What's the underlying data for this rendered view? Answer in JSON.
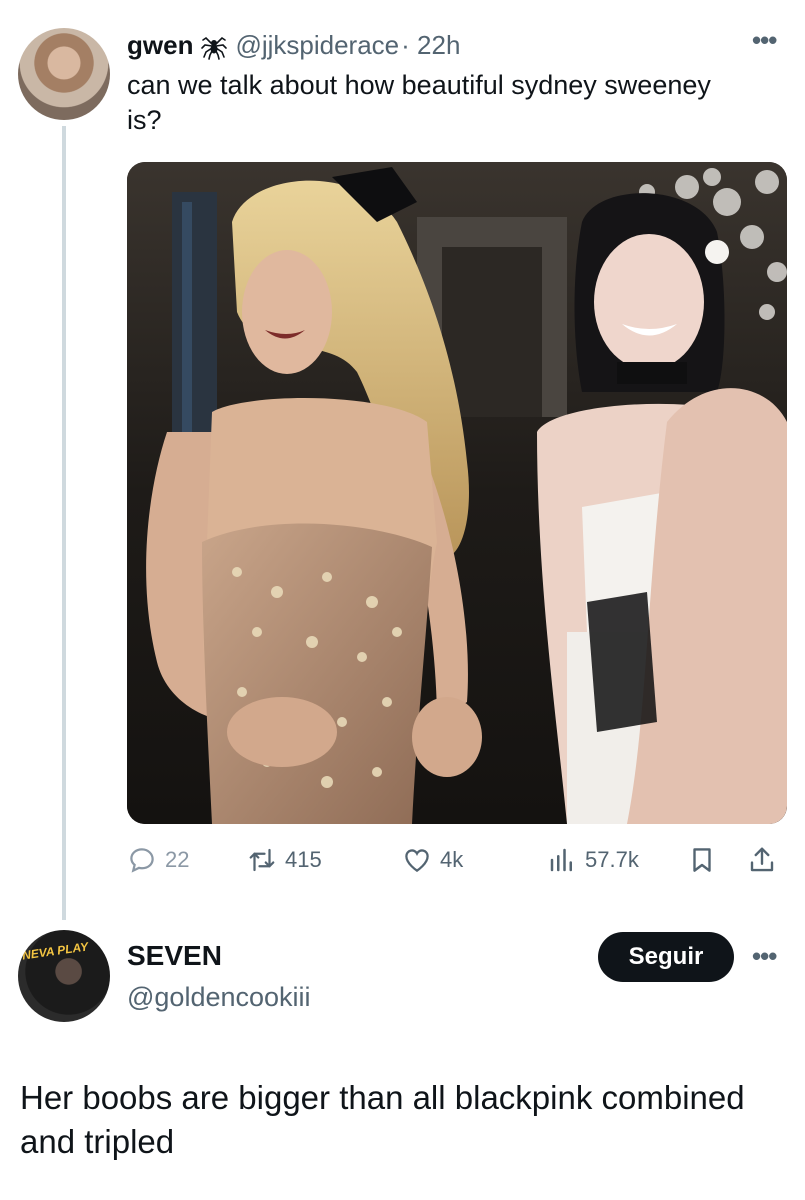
{
  "tweet": {
    "author_name": "gwen",
    "handle": "@jjkspiderace",
    "time": "· 22h",
    "text": "can we talk about how beautiful sydney sweeney is?",
    "stats": {
      "replies": "22",
      "retweets": "415",
      "likes": "4k",
      "views": "57.7k"
    }
  },
  "reply": {
    "author_name": "SEVEN",
    "handle": "@goldencookiii",
    "follow_label": "Seguir",
    "avatar_badge": "NEVA PLAY",
    "text": "Her boobs are bigger than all blackpink combined and tripled"
  },
  "icons": {
    "more": "more-icon",
    "reply": "comment-icon",
    "retweet": "retweet-icon",
    "like": "heart-icon",
    "views": "views-icon",
    "bookmark": "bookmark-icon",
    "share": "share-icon"
  },
  "colors": {
    "text": "#0f1419",
    "muted": "#536471",
    "button_bg": "#0f1419",
    "thread_line": "#cfd9de"
  }
}
